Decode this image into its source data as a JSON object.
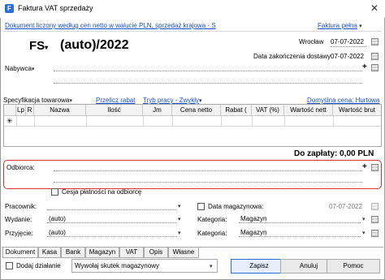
{
  "window": {
    "title": "Faktura VAT sprzedaży",
    "close_glyph": "✕",
    "icon_glyph": "F"
  },
  "header": {
    "doc_desc": "Dokument liczony według cen netto w walucie PLN, sprzedaż krajowa - S",
    "doc_type_link": "Faktura pełna",
    "doc_prefix": "FS",
    "doc_prefix_arrow": "▾",
    "doc_number": "(auto)/2022",
    "city": "Wrocław",
    "date_issue": "07-07-2022",
    "date_end_label": "Data zakończenia dostawy",
    "date_end": "07-07-2022",
    "buyer_label": "Nabywca",
    "buyer_arrow": "▾"
  },
  "spec": {
    "label": "Specyfikacja towarowa",
    "recalc_link": "Przelicz rabat",
    "mode_link": "Tryb pracy - Zwykły",
    "price_link": "Domyślna cena: Hurtowa",
    "arrow": "▾"
  },
  "table": {
    "columns": [
      "Lp",
      "R",
      "Nazwa",
      "Ilość",
      "Jm",
      "Cena netto",
      "Rabat (",
      "VAT (%)",
      "Wartość nett",
      "Wartość brut"
    ],
    "new_row_marker": "✳"
  },
  "total": {
    "label": "Do zapłaty: 0,00 PLN"
  },
  "recipient": {
    "label": "Odbiorca:",
    "plus": "+"
  },
  "cession": {
    "label": "Cesja płatności na odbiorcę"
  },
  "form": {
    "worker_label": "Pracownik:",
    "issued_label": "Wydanie:",
    "issued_value": "(auto)",
    "accepted_label": "Przyjęcie:",
    "accepted_value": "(auto)",
    "warehouse_date_label": "Data magazynowa:",
    "warehouse_date": "07-07-2022",
    "category_label_1": "Kategoria:",
    "category_value_1": "Magazyn",
    "category_label_2": "Kategoria:",
    "category_value_2": "Magazyn"
  },
  "tabs": [
    "Dokument",
    "Kasa",
    "Bank",
    "Magazyn",
    "VAT",
    "Opis",
    "Własne"
  ],
  "footer": {
    "add_action_label": "Dodaj działanie",
    "action_value": "Wywołaj skutek magazynowy",
    "save": "Zapisz",
    "cancel": "Anuluj",
    "help": "Pomoc",
    "arrow": "▾"
  },
  "colors": {
    "link": "#1a4fd0",
    "highlight_border": "#e0302e",
    "primary_button_border": "#2a6fd6"
  }
}
